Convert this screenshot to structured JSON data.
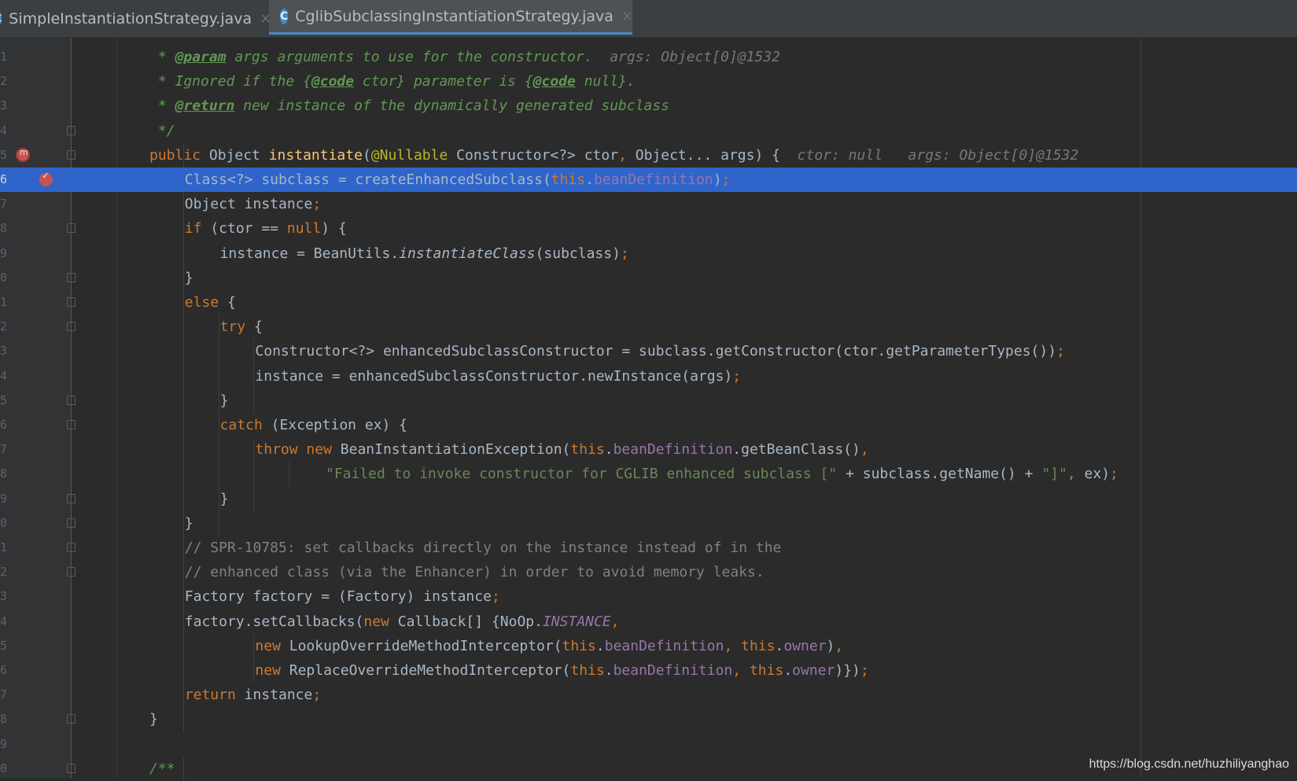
{
  "tabs": [
    {
      "label": "SimpleInstantiationStrategy.java",
      "icon": "java-class-icon",
      "icon_glyph": "C",
      "active": false,
      "close_glyph": "×"
    },
    {
      "label": "CglibSubclassingInstantiationStrategy.java",
      "icon": "java-class-icon",
      "icon_glyph": "C",
      "active": true,
      "close_glyph": "×"
    }
  ],
  "editor": {
    "highlight_color": "#2f65ca",
    "lines": [
      {
        "num": "1",
        "indent": 1,
        "tokens": [
          [
            "doc",
            " * "
          ],
          [
            "doctag",
            "@param"
          ],
          [
            "doc",
            " args arguments to use for the constructor."
          ]
        ],
        "hint": "  args: Object[0]@1532"
      },
      {
        "num": "2",
        "indent": 1,
        "tokens": [
          [
            "doc",
            " * Ignored if the {"
          ],
          [
            "doctag",
            "@code"
          ],
          [
            "doc",
            " ctor} parameter is {"
          ],
          [
            "doctag",
            "@code"
          ],
          [
            "doc",
            " null}."
          ]
        ]
      },
      {
        "num": "3",
        "indent": 1,
        "tokens": [
          [
            "doc",
            " * "
          ],
          [
            "doctag",
            "@return"
          ],
          [
            "doc",
            " new instance of the dynamically generated subclass"
          ]
        ]
      },
      {
        "num": "4",
        "indent": 1,
        "fold": true,
        "tokens": [
          [
            "doc",
            " */"
          ]
        ]
      },
      {
        "num": "5",
        "indent": 1,
        "fold": true,
        "method_breakpoint": true,
        "tokens": [
          [
            "kw",
            "public "
          ],
          [
            "plain",
            "Object "
          ],
          [
            "fn",
            "instantiate"
          ],
          [
            "plain",
            "("
          ],
          [
            "ann",
            "@Nullable "
          ],
          [
            "plain",
            "Constructor<?> ctor"
          ],
          [
            "kw",
            ", "
          ],
          [
            "plain",
            "Object... args) {"
          ]
        ],
        "hint": "  ctor: null   args: Object[0]@1532"
      },
      {
        "num": "6",
        "indent": 2,
        "highlight": true,
        "breakpoint": true,
        "tokens": [
          [
            "plain",
            "Class<?> subclass = createEnhancedSubclass("
          ],
          [
            "kw",
            "this"
          ],
          [
            "plain",
            "."
          ],
          [
            "fld",
            "beanDefinition"
          ],
          [
            "plain",
            ")"
          ],
          [
            "kw",
            ";"
          ]
        ]
      },
      {
        "num": "7",
        "indent": 2,
        "tokens": [
          [
            "plain",
            "Object instance"
          ],
          [
            "kw",
            ";"
          ]
        ]
      },
      {
        "num": "8",
        "indent": 2,
        "fold": true,
        "tokens": [
          [
            "kw",
            "if "
          ],
          [
            "plain",
            "(ctor == "
          ],
          [
            "kw",
            "null"
          ],
          [
            "plain",
            ") {"
          ]
        ]
      },
      {
        "num": "9",
        "indent": 3,
        "tokens": [
          [
            "plain",
            "instance = BeanUtils."
          ],
          [
            "italic",
            "instantiateClass"
          ],
          [
            "plain",
            "(subclass)"
          ],
          [
            "kw",
            ";"
          ]
        ]
      },
      {
        "num": "0",
        "indent": 2,
        "fold": true,
        "tokens": [
          [
            "plain",
            "}"
          ]
        ]
      },
      {
        "num": "1",
        "indent": 2,
        "fold": true,
        "tokens": [
          [
            "kw",
            "else "
          ],
          [
            "plain",
            "{"
          ]
        ]
      },
      {
        "num": "2",
        "indent": 3,
        "fold": true,
        "tokens": [
          [
            "kw",
            "try "
          ],
          [
            "plain",
            "{"
          ]
        ]
      },
      {
        "num": "3",
        "indent": 4,
        "tokens": [
          [
            "plain",
            "Constructor<?> enhancedSubclassConstructor = subclass.getConstructor(ctor.getParameterTypes())"
          ],
          [
            "kw",
            ";"
          ]
        ]
      },
      {
        "num": "4",
        "indent": 4,
        "tokens": [
          [
            "plain",
            "instance = enhancedSubclassConstructor.newInstance(args)"
          ],
          [
            "kw",
            ";"
          ]
        ]
      },
      {
        "num": "5",
        "indent": 3,
        "fold": true,
        "tokens": [
          [
            "plain",
            "}"
          ]
        ]
      },
      {
        "num": "6",
        "indent": 3,
        "fold": true,
        "tokens": [
          [
            "kw",
            "catch "
          ],
          [
            "plain",
            "(Exception ex) {"
          ]
        ]
      },
      {
        "num": "7",
        "indent": 4,
        "tokens": [
          [
            "kw",
            "throw new "
          ],
          [
            "plain",
            "BeanInstantiationException("
          ],
          [
            "kw",
            "this"
          ],
          [
            "plain",
            "."
          ],
          [
            "fld",
            "beanDefinition"
          ],
          [
            "plain",
            ".getBeanClass()"
          ],
          [
            "kw",
            ","
          ]
        ]
      },
      {
        "num": "8",
        "indent": 6,
        "tokens": [
          [
            "str",
            "\"Failed to invoke constructor for CGLIB enhanced subclass [\" "
          ],
          [
            "plain",
            "+ subclass.getName() + "
          ],
          [
            "str",
            "\"]\""
          ],
          [
            "kw",
            ", "
          ],
          [
            "plain",
            "ex)"
          ],
          [
            "kw",
            ";"
          ]
        ]
      },
      {
        "num": "9",
        "indent": 3,
        "fold": true,
        "tokens": [
          [
            "plain",
            "}"
          ]
        ]
      },
      {
        "num": "0",
        "indent": 2,
        "fold": true,
        "tokens": [
          [
            "plain",
            "}"
          ]
        ]
      },
      {
        "num": "1",
        "indent": 2,
        "fold": true,
        "tokens": [
          [
            "cm",
            "// SPR-10785: set callbacks directly on the instance instead of in the"
          ]
        ]
      },
      {
        "num": "2",
        "indent": 2,
        "fold": true,
        "tokens": [
          [
            "cm",
            "// enhanced class (via the Enhancer) in order to avoid memory leaks."
          ]
        ]
      },
      {
        "num": "3",
        "indent": 2,
        "tokens": [
          [
            "plain",
            "Factory factory = (Factory) instance"
          ],
          [
            "kw",
            ";"
          ]
        ]
      },
      {
        "num": "4",
        "indent": 2,
        "tokens": [
          [
            "plain",
            "factory.setCallbacks("
          ],
          [
            "kw",
            "new "
          ],
          [
            "plain",
            "Callback[] {NoOp."
          ],
          [
            "static",
            "INSTANCE"
          ],
          [
            "kw",
            ","
          ]
        ]
      },
      {
        "num": "5",
        "indent": 4,
        "tokens": [
          [
            "kw",
            "new "
          ],
          [
            "plain",
            "LookupOverrideMethodInterceptor("
          ],
          [
            "kw",
            "this"
          ],
          [
            "plain",
            "."
          ],
          [
            "fld",
            "beanDefinition"
          ],
          [
            "kw",
            ", this"
          ],
          [
            "plain",
            "."
          ],
          [
            "fld",
            "owner"
          ],
          [
            "plain",
            ")"
          ],
          [
            "kw",
            ","
          ]
        ]
      },
      {
        "num": "6",
        "indent": 4,
        "tokens": [
          [
            "kw",
            "new "
          ],
          [
            "plain",
            "ReplaceOverrideMethodInterceptor("
          ],
          [
            "kw",
            "this"
          ],
          [
            "plain",
            "."
          ],
          [
            "fld",
            "beanDefinition"
          ],
          [
            "kw",
            ", this"
          ],
          [
            "plain",
            "."
          ],
          [
            "fld",
            "owner"
          ],
          [
            "plain",
            ")})"
          ],
          [
            "kw",
            ";"
          ]
        ]
      },
      {
        "num": "7",
        "indent": 2,
        "tokens": [
          [
            "kw",
            "return "
          ],
          [
            "plain",
            "instance"
          ],
          [
            "kw",
            ";"
          ]
        ]
      },
      {
        "num": "8",
        "indent": 1,
        "fold": true,
        "tokens": [
          [
            "plain",
            "}"
          ]
        ]
      },
      {
        "num": "9",
        "indent": 1,
        "tokens": []
      },
      {
        "num": "0",
        "indent": 1,
        "fold": true,
        "tokens": [
          [
            "doc",
            "/**"
          ]
        ]
      }
    ]
  },
  "watermark": "https://blog.csdn.net/huzhiliyanghao"
}
